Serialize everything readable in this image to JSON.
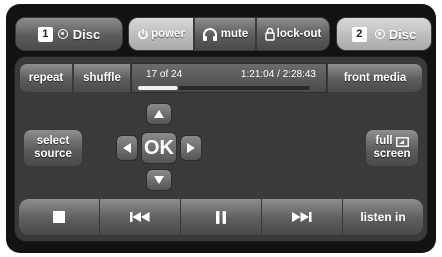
{
  "zones": {
    "zone1": {
      "number": "1",
      "source": "Disc",
      "icon": "disc-icon"
    },
    "zone2": {
      "number": "2",
      "source": "Disc",
      "icon": "disc-icon"
    }
  },
  "global": {
    "power": "power",
    "mute": "mute",
    "lockout": "lock-out"
  },
  "transport_top": {
    "repeat": "repeat",
    "shuffle": "shuffle",
    "front_media": "front media"
  },
  "status": {
    "track": "17 of 24",
    "time": "1:21:04 / 2:28:43",
    "progress": 0.23
  },
  "nav": {
    "select_source_line1": "select",
    "select_source_line2": "source",
    "ok": "OK",
    "full_screen_line1": "full",
    "full_screen_line2": "screen"
  },
  "bottom": {
    "stop": "stop-icon",
    "prev": "previous-icon",
    "pause": "pause-icon",
    "next": "next-icon",
    "listen_in": "listen in"
  }
}
